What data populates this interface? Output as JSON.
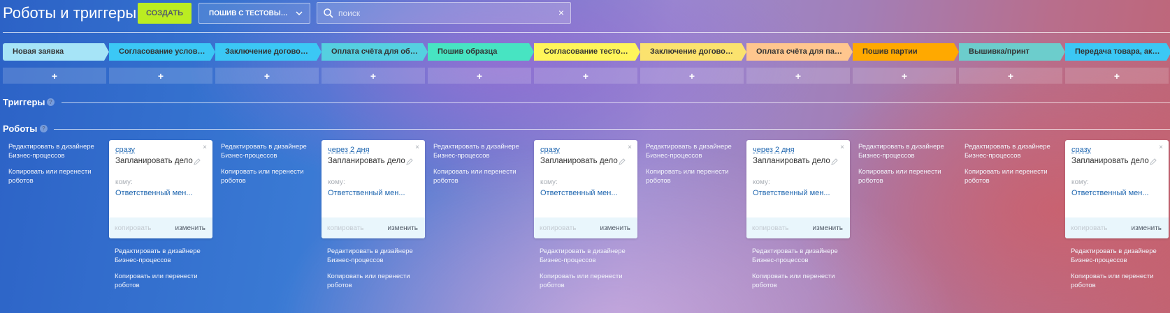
{
  "header": {
    "title": "Роботы и триггеры",
    "create_label": "Создать",
    "pipeline_label": "ПОШИВ С ТЕСТОВЫМ О...",
    "search_placeholder": "поиск",
    "clear_symbol": "×"
  },
  "stages": [
    {
      "label": "Новая заявка",
      "color": "#a6e4f7"
    },
    {
      "label": "Согласование условий...",
      "color": "#3bc8f5"
    },
    {
      "label": "Заключение договора ...",
      "color": "#3bc8f5"
    },
    {
      "label": "Оплата счёта для обра...",
      "color": "#55d0e0"
    },
    {
      "label": "Пошив образца",
      "color": "#47e4c2"
    },
    {
      "label": "Согласование тестовог...",
      "color": "#fff55a"
    },
    {
      "label": "Заключение договора ...",
      "color": "#fbe26e"
    },
    {
      "label": "Оплата счёта для парт...",
      "color": "#ffc68e"
    },
    {
      "label": "Пошив партии",
      "color": "#ffa900"
    },
    {
      "label": "Вышивка/принт",
      "color": "#6ccdcc"
    },
    {
      "label": "Передача товара, акты...",
      "color": "#3bc8f5"
    }
  ],
  "add_symbol": "+",
  "triggers": {
    "title": "Триггеры",
    "help": "?"
  },
  "robots": {
    "title": "Роботы",
    "help": "?"
  },
  "column_links": {
    "edit": "Редактировать в дизайнере Бизнес-процессов",
    "copy": "Копировать или перенести роботов"
  },
  "cards": [
    {
      "delay": "сразу",
      "action": "Запланировать дело",
      "to_label": "кому:",
      "responsible": "Ответственный мен...",
      "copy": "копировать",
      "edit": "изменить",
      "close": "×"
    },
    {
      "delay": "через 2 дня",
      "action": "Запланировать дело",
      "to_label": "кому:",
      "responsible": "Ответственный мен...",
      "copy": "копировать",
      "edit": "изменить",
      "close": "×"
    },
    {
      "delay": "сразу",
      "action": "Запланировать дело",
      "to_label": "кому:",
      "responsible": "Ответственный мен...",
      "copy": "копировать",
      "edit": "изменить",
      "close": "×"
    },
    {
      "delay": "через 2 дня",
      "action": "Запланировать дело",
      "to_label": "кому:",
      "responsible": "Ответственный мен...",
      "copy": "копировать",
      "edit": "изменить",
      "close": "×"
    },
    {
      "delay": "сразу",
      "action": "Запланировать дело",
      "to_label": "кому:",
      "responsible": "Ответственный мен...",
      "copy": "копировать",
      "edit": "изменить",
      "close": "×"
    }
  ]
}
